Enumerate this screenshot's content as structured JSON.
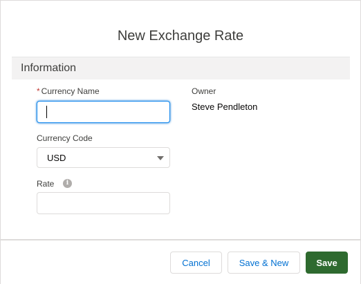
{
  "modal": {
    "title": "New Exchange Rate"
  },
  "section": {
    "title": "Information"
  },
  "fields": {
    "currency_name": {
      "label": "Currency Name",
      "required_marker": "*",
      "value": ""
    },
    "currency_code": {
      "label": "Currency Code",
      "value": "USD"
    },
    "rate": {
      "label": "Rate",
      "info_icon": "info-icon",
      "value": ""
    },
    "owner": {
      "label": "Owner",
      "value": "Steve Pendleton"
    }
  },
  "footer": {
    "cancel_label": "Cancel",
    "save_new_label": "Save & New",
    "save_label": "Save"
  },
  "colors": {
    "brand_button": "#2e6a2f",
    "link_blue": "#0070d2",
    "required_red": "#c23934",
    "focus_border": "#1589ee"
  }
}
